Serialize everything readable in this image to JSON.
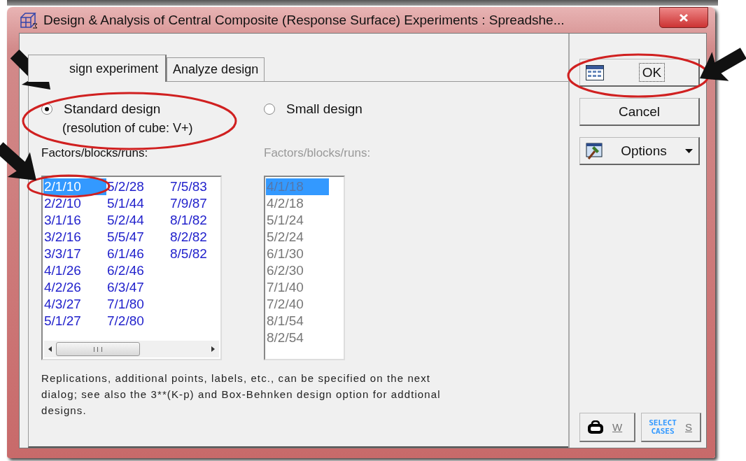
{
  "window": {
    "title": "Design & Analysis of Central Composite (Response Surface) Experiments : Spreadshe..."
  },
  "tabs": [
    {
      "label": "sign experiment",
      "selected": true
    },
    {
      "label": "Analyze design",
      "selected": false
    }
  ],
  "designs": [
    {
      "kind": "multi-column",
      "label": "Standard design",
      "sublabel": "(resolution of cube: V+)",
      "selected": true,
      "disabled": false,
      "list_label": "Factors/blocks/runs:",
      "items": [
        {
          "text": "2/1/10",
          "selected": true
        },
        {
          "text": "2/2/10",
          "selected": false
        },
        {
          "text": "3/1/16",
          "selected": false
        },
        {
          "text": "3/2/16",
          "selected": false
        },
        {
          "text": "3/3/17",
          "selected": false
        },
        {
          "text": "4/1/26",
          "selected": false
        },
        {
          "text": "4/2/26",
          "selected": false
        },
        {
          "text": "4/3/27",
          "selected": false
        },
        {
          "text": "5/1/27",
          "selected": false
        },
        {
          "text": "5/2/28",
          "selected": false
        },
        {
          "text": "5/1/44",
          "selected": false
        },
        {
          "text": "5/2/44",
          "selected": false
        },
        {
          "text": "5/5/47",
          "selected": false
        },
        {
          "text": "6/1/46",
          "selected": false
        },
        {
          "text": "6/2/46",
          "selected": false
        },
        {
          "text": "6/3/47",
          "selected": false
        },
        {
          "text": "7/1/80",
          "selected": false
        },
        {
          "text": "7/2/80",
          "selected": false
        },
        {
          "text": "7/5/83",
          "selected": false
        },
        {
          "text": "7/9/87",
          "selected": false
        },
        {
          "text": "8/1/82",
          "selected": false
        },
        {
          "text": "8/2/82",
          "selected": false
        },
        {
          "text": "8/5/82",
          "selected": false
        }
      ]
    },
    {
      "kind": "single-column",
      "label": "Small design",
      "selected": false,
      "disabled": true,
      "list_label": "Factors/blocks/runs:",
      "items": [
        {
          "text": "4/1/18",
          "selected": true
        },
        {
          "text": "4/2/18",
          "selected": false
        },
        {
          "text": "5/1/24",
          "selected": false
        },
        {
          "text": "5/2/24",
          "selected": false
        },
        {
          "text": "6/1/30",
          "selected": false
        },
        {
          "text": "6/2/30",
          "selected": false
        },
        {
          "text": "7/1/40",
          "selected": false
        },
        {
          "text": "7/2/40",
          "selected": false
        },
        {
          "text": "8/1/54",
          "selected": false
        },
        {
          "text": "8/2/54",
          "selected": false
        }
      ]
    }
  ],
  "note": "Replications, additional points, labels, etc., can be specified on the next dialog; see also the 3**(K-p) and Box-Behnken design option for addtional designs.",
  "buttons": [
    {
      "kind": "ok",
      "label": "OK",
      "focused": true
    },
    {
      "kind": "cancel",
      "label": "Cancel",
      "focused": false
    },
    {
      "kind": "options",
      "label": "Options",
      "focused": false
    }
  ],
  "tool_buttons": [
    {
      "kind": "weights",
      "label": "W"
    },
    {
      "kind": "select",
      "caption": "SELECT CASES",
      "label": "S"
    }
  ]
}
